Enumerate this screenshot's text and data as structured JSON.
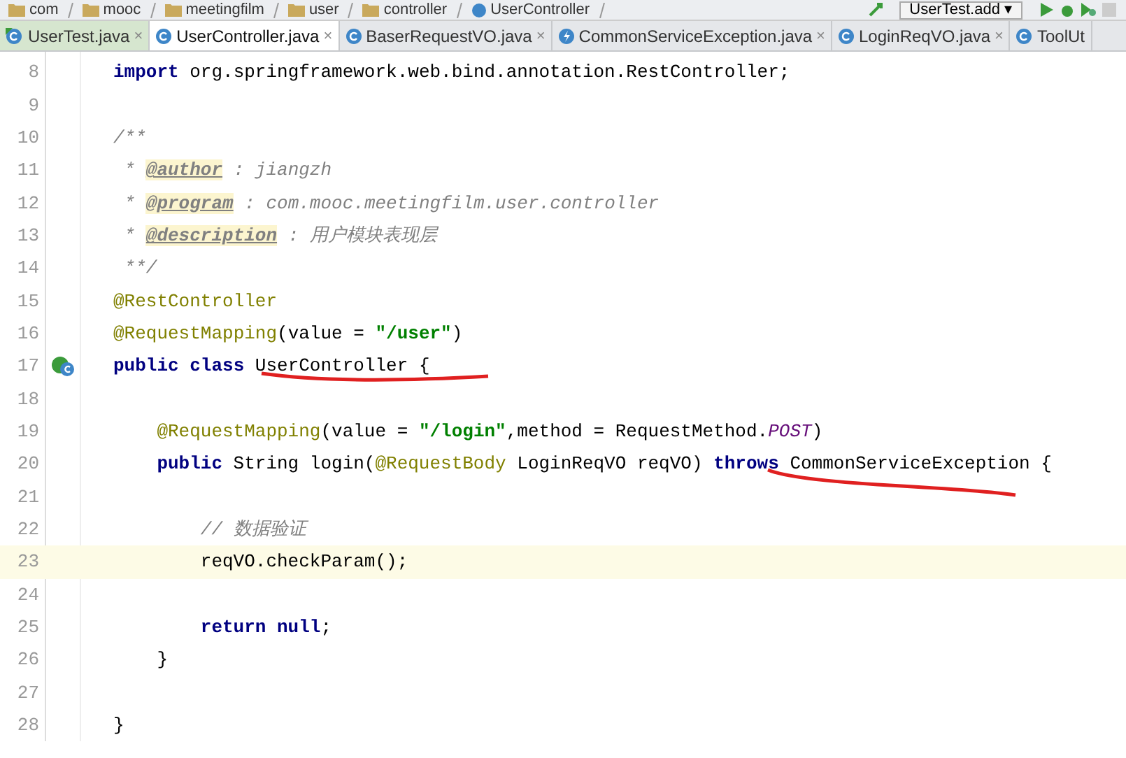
{
  "breadcrumb": [
    "com",
    "mooc",
    "meetingfilm",
    "user",
    "controller",
    "UserController"
  ],
  "run_config": {
    "label": "UserTest.add",
    "caret": "▾"
  },
  "tabs": [
    {
      "label": "UserTest.java",
      "kind": "test",
      "selected": false,
      "close": "×"
    },
    {
      "label": "UserController.java",
      "kind": "class",
      "selected": true,
      "close": "×"
    },
    {
      "label": "BaserRequestVO.java",
      "kind": "class",
      "selected": false,
      "close": "×"
    },
    {
      "label": "CommonServiceException.java",
      "kind": "exception",
      "selected": false,
      "close": "×"
    },
    {
      "label": "LoginReqVO.java",
      "kind": "class",
      "selected": false,
      "close": "×"
    },
    {
      "label": "ToolUt",
      "kind": "class",
      "selected": false
    }
  ],
  "lines": [
    {
      "number": "8",
      "kind": "top",
      "tokens": [
        {
          "text": "import",
          "kind": "keyword"
        },
        {
          "text": " org.springframework.web.bind.annotation.RestController;",
          "kind": "plain"
        }
      ]
    },
    {
      "number": "9"
    },
    {
      "number": "10",
      "kind": "top",
      "tokens": [
        {
          "text": "/**",
          "kind": "comment"
        }
      ]
    },
    {
      "number": "11",
      "kind": "top",
      "tokens": [
        {
          "text": " * ",
          "kind": "comment"
        },
        {
          "text": "@author",
          "kind": "doctag"
        },
        {
          "text": " : jiangzh",
          "kind": "comment"
        }
      ]
    },
    {
      "number": "12",
      "kind": "top",
      "tokens": [
        {
          "text": " * ",
          "kind": "comment"
        },
        {
          "text": "@program",
          "kind": "doctag"
        },
        {
          "text": " : com.mooc.meetingfilm.user.controller",
          "kind": "comment"
        }
      ]
    },
    {
      "number": "13",
      "kind": "top",
      "tokens": [
        {
          "text": " * ",
          "kind": "comment"
        },
        {
          "text": "@description",
          "kind": "doctag"
        },
        {
          "text": " : 用户模块表现层",
          "kind": "comment"
        }
      ]
    },
    {
      "number": "14",
      "kind": "top",
      "tokens": [
        {
          "text": " **/",
          "kind": "comment"
        }
      ]
    },
    {
      "number": "15",
      "kind": "top",
      "tokens": [
        {
          "text": "@RestController",
          "kind": "annotation"
        }
      ]
    },
    {
      "number": "16",
      "kind": "top",
      "tokens": [
        {
          "text": "@RequestMapping",
          "kind": "annotation"
        },
        {
          "text": "(value = ",
          "kind": "plain"
        },
        {
          "text": "\"/user\"",
          "kind": "string"
        },
        {
          "text": ")",
          "kind": "plain"
        }
      ]
    },
    {
      "number": "17",
      "kind": "top",
      "run_marker": true,
      "tokens": [
        {
          "text": "public class",
          "kind": "keyword"
        },
        {
          "text": " UserController {",
          "kind": "plain"
        }
      ]
    },
    {
      "number": "18"
    },
    {
      "number": "19",
      "kind": "member",
      "tokens": [
        {
          "text": "@RequestMapping",
          "kind": "annotation"
        },
        {
          "text": "(value = ",
          "kind": "plain"
        },
        {
          "text": "\"/login\"",
          "kind": "string"
        },
        {
          "text": ",method = RequestMethod.",
          "kind": "plain"
        },
        {
          "text": "POST",
          "kind": "constant"
        },
        {
          "text": ")",
          "kind": "plain"
        }
      ]
    },
    {
      "number": "20",
      "kind": "member",
      "tokens": [
        {
          "text": "public",
          "kind": "keyword"
        },
        {
          "text": " String login(",
          "kind": "plain"
        },
        {
          "text": "@RequestBody",
          "kind": "annotation"
        },
        {
          "text": " LoginReqVO reqVO) ",
          "kind": "plain"
        },
        {
          "text": "throws",
          "kind": "keyword"
        },
        {
          "text": " CommonServiceException {",
          "kind": "plain"
        }
      ]
    },
    {
      "number": "21"
    },
    {
      "number": "22",
      "kind": "body",
      "tokens": [
        {
          "text": "// 数据验证",
          "kind": "comment"
        }
      ]
    },
    {
      "number": "23",
      "kind": "body",
      "current": true,
      "tokens": [
        {
          "text": "reqVO.checkParam();",
          "kind": "plain"
        }
      ]
    },
    {
      "number": "24"
    },
    {
      "number": "25",
      "kind": "body",
      "tokens": [
        {
          "text": "return null",
          "kind": "keyword"
        },
        {
          "text": ";",
          "kind": "plain"
        }
      ]
    },
    {
      "number": "26",
      "kind": "member",
      "tokens": [
        {
          "text": "}",
          "kind": "plain"
        }
      ]
    },
    {
      "number": "27"
    },
    {
      "number": "28",
      "kind": "top",
      "tokens": [
        {
          "text": "}",
          "kind": "plain"
        }
      ]
    }
  ]
}
